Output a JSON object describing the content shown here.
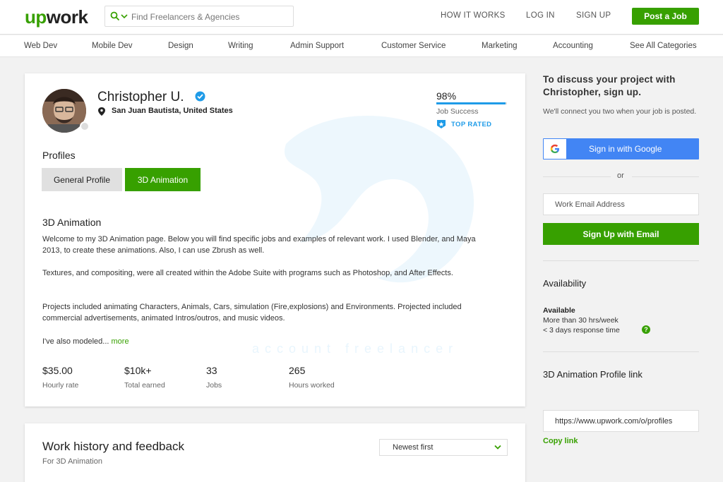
{
  "header": {
    "logo_up": "up",
    "logo_work": "work",
    "search_placeholder": "Find Freelancers & Agencies",
    "nav": [
      "HOW IT WORKS",
      "LOG IN",
      "SIGN UP"
    ],
    "post_job": "Post a Job"
  },
  "categories": [
    "Web Dev",
    "Mobile Dev",
    "Design",
    "Writing",
    "Admin Support",
    "Customer Service",
    "Marketing",
    "Accounting",
    "See All Categories"
  ],
  "profile": {
    "name": "Christopher U.",
    "location": "San Juan Bautista, United States",
    "job_success_value": "98%",
    "job_success_fraction": 0.98,
    "job_success_label": "Job Success",
    "badge": "TOP RATED",
    "profiles_heading": "Profiles",
    "tabs": [
      "General Profile",
      "3D Animation"
    ],
    "section_title": "3D Animation",
    "paragraphs": [
      "Welcome to my 3D Animation page. Below you will find specific jobs and examples of relevant work. I used Blender, and Maya 2013, to create these animations. Also, I can use Zbrush as well.",
      "Textures, and compositing, were all created within the Adobe Suite with programs such as Photoshop, and After Effects.",
      "Projects included animating Characters, Animals, Cars, simulation (Fire,explosions) and Environments. Projected included commercial advertisements, animated Intros/outros, and music videos.",
      "I've also modeled..."
    ],
    "more_link": "more",
    "stats": [
      {
        "value": "$35.00",
        "label": "Hourly rate"
      },
      {
        "value": "$10k+",
        "label": "Total earned"
      },
      {
        "value": "33",
        "label": "Jobs"
      },
      {
        "value": "265",
        "label": "Hours worked"
      }
    ],
    "watermark": "account freelancer"
  },
  "work_history": {
    "title": "Work history and feedback",
    "subtitle": "For 3D Animation",
    "sort_value": "Newest first"
  },
  "sidebar": {
    "heading": "To discuss your project with Christopher, sign up.",
    "text": "We'll connect you two when your job is posted.",
    "google_button": "Sign in with Google",
    "or": "or",
    "email_placeholder": "Work Email Address",
    "signup_button": "Sign Up with Email",
    "availability_heading": "Availability",
    "availability_status": "Available",
    "availability_hours": "More than 30 hrs/week",
    "availability_response": "< 3 days response time",
    "profile_link_heading": "3D Animation Profile link",
    "profile_link_value": "https://www.upwork.com/o/profiles",
    "copy_link": "Copy link"
  },
  "colors": {
    "brand_green": "#37a000",
    "accent_blue": "#1e9be8",
    "google_blue": "#4285f4"
  }
}
